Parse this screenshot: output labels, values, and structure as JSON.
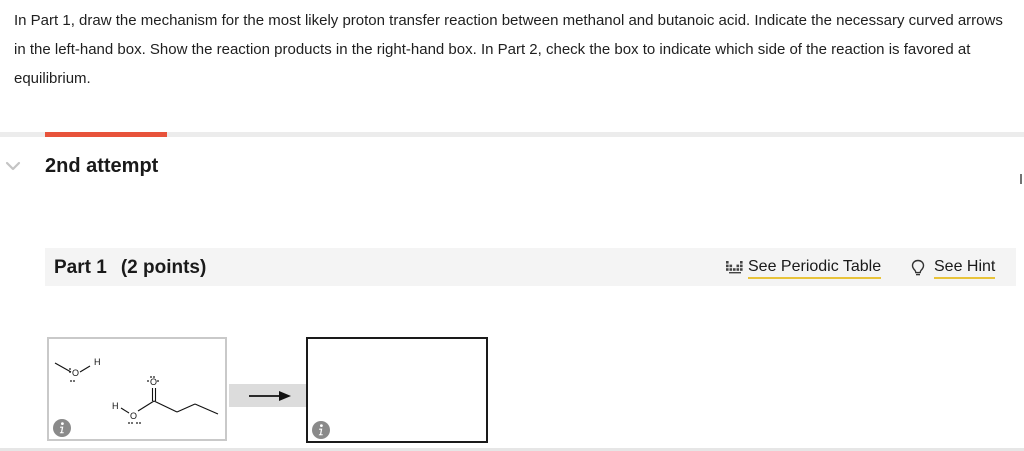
{
  "question": {
    "text": "In Part 1, draw the mechanism for the most likely proton transfer reaction between methanol and butanoic acid. Indicate the necessary curved arrows in the left-hand box. Show the reaction products in the right-hand box. In Part 2, check the box to indicate which side of the reaction is favored at equilibrium."
  },
  "attempt": {
    "title": "2nd attempt",
    "chevron_icon": "chevron-down-icon"
  },
  "part": {
    "label": "Part 1",
    "points": "(2 points)",
    "periodic_link": "See Periodic Table",
    "periodic_icon": "periodic-table-icon",
    "hint_link": "See Hint",
    "hint_icon": "lightbulb-icon"
  },
  "reactants": {
    "methanol_H": "H",
    "methanol_O": "O",
    "acid_H": "H",
    "acid_O": "O",
    "carbonyl_O": "O"
  },
  "colors": {
    "accent": "#e8533b",
    "link_underline": "#e8c33a",
    "info_icon": "#8a8a8a"
  }
}
